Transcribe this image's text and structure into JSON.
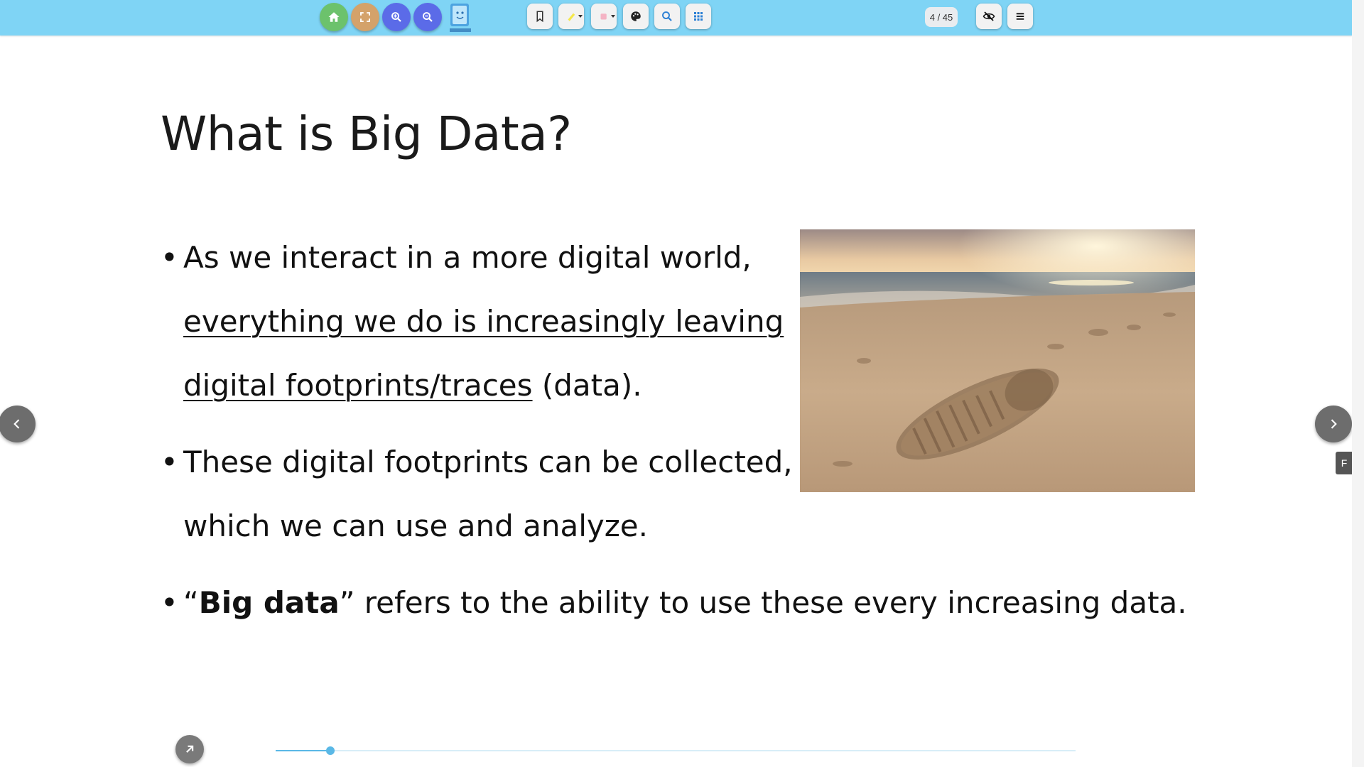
{
  "toolbar": {
    "buttons": [
      {
        "name": "home-button",
        "icon": "home-icon",
        "color": "#6cc26c"
      },
      {
        "name": "fullscreen-button",
        "icon": "fullscreen-icon",
        "color": "#d4a26a"
      },
      {
        "name": "zoom-in-button",
        "icon": "zoom-in-icon",
        "color": "#5b6be8"
      },
      {
        "name": "zoom-out-button",
        "icon": "zoom-out-icon",
        "color": "#5b6be8"
      }
    ],
    "tools": [
      "bookmark-icon",
      "highlighter-icon",
      "eraser-icon",
      "palette-icon",
      "search-icon",
      "grid-icon"
    ],
    "page_indicator": "4 / 45",
    "right_tools": [
      "hide-icon",
      "menu-icon"
    ]
  },
  "slide": {
    "title": "What is Big Data?",
    "bullet1": {
      "part1": "As we interact in a more digital world,",
      "underlined": "everything we do is increasingly leaving digital footprints/traces",
      "part2": " (data)."
    },
    "bullet2": {
      "text": "These digital footprints can be collected, which we can use and analyze."
    },
    "bullet3": {
      "quote_open": "“",
      "bold": "Big data",
      "rest": "” refers to the ability to use these every increasing data."
    },
    "image_description": "footprint-in-sand-photo"
  },
  "nav": {
    "prev_icon": "chevron-left-icon",
    "next_icon": "chevron-right-icon",
    "side_tab": "F"
  },
  "progress": {
    "current_page": 4,
    "total_pages": 45,
    "fraction": 0.0683
  },
  "colors": {
    "toolbar_bg": "#7fd4f5",
    "accent": "#5ab8e6"
  }
}
